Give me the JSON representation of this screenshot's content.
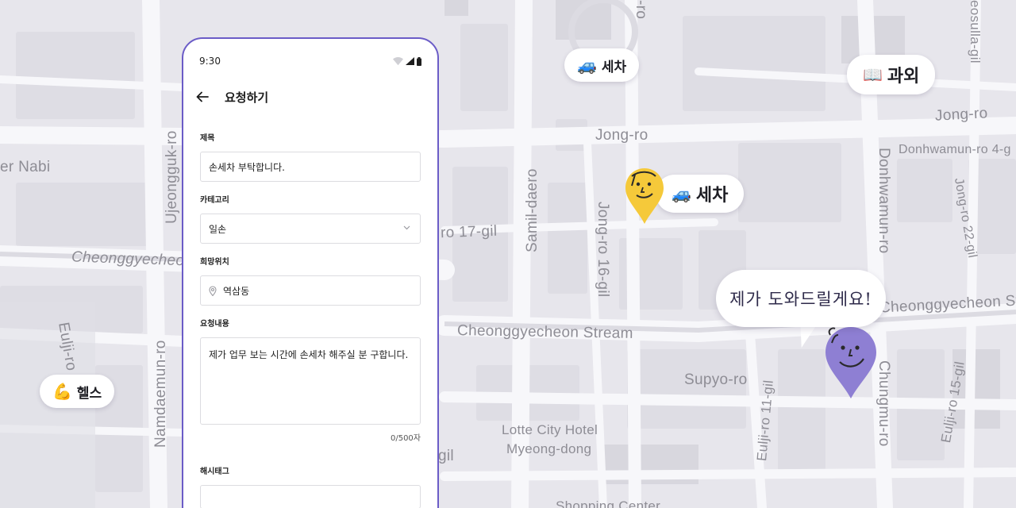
{
  "map": {
    "streets": [
      "Jong-ro",
      "Jong-ro",
      "Cheonggyecheon Stream",
      "Cheonggyecheon",
      "Cheonggyecheon St",
      "Samil-daero",
      "Jong-ro 16-gil",
      "Donhwamun-ro",
      "Donhwamun-ro 4-g",
      "Jong-ro 22-gil",
      "Ujeongguk-ro",
      "Namdaemun-ro",
      "Eulji-ro",
      "Supyo-ro",
      "Eulji-ro 11-gil",
      "Chungmu-ro",
      "Eulji-ro 15-gil",
      "ro 17-gil",
      "er Nabi",
      "gil",
      "eosulla-gil",
      "-ro"
    ],
    "poi": {
      "line1": "Lotte City Hotel",
      "line2": "Myeong-dong",
      "bottom": "Shopping Center"
    }
  },
  "chips": {
    "carwash_small": {
      "emoji": "🚙",
      "label": "세차"
    },
    "tutoring": {
      "emoji": "📖",
      "label": "과외"
    },
    "carwash_large": {
      "emoji": "🚙",
      "label": "세차"
    },
    "fitness": {
      "emoji": "💪",
      "label": "헬스"
    }
  },
  "bubble": {
    "text": "제가 도와드릴게요!"
  },
  "phone": {
    "time": "9:30",
    "title": "요청하기",
    "fields": {
      "title_label": "제목",
      "title_value": "손세차 부탁합니다.",
      "category_label": "카테고리",
      "category_value": "일손",
      "location_label": "희망위치",
      "location_value": "역삼동",
      "content_label": "요청내용",
      "content_value": "제가 업무 보는 시간에 손세차 해주실 분 구합니다.",
      "content_counter": "0/500자",
      "hashtag_label": "해시태그"
    }
  },
  "colors": {
    "accent": "#6b5cc7",
    "pin_yellow": "#f5c93a",
    "pin_purple": "#8e7fd3",
    "map_bg": "#e7e6ec",
    "road": "#f6f6f9"
  }
}
